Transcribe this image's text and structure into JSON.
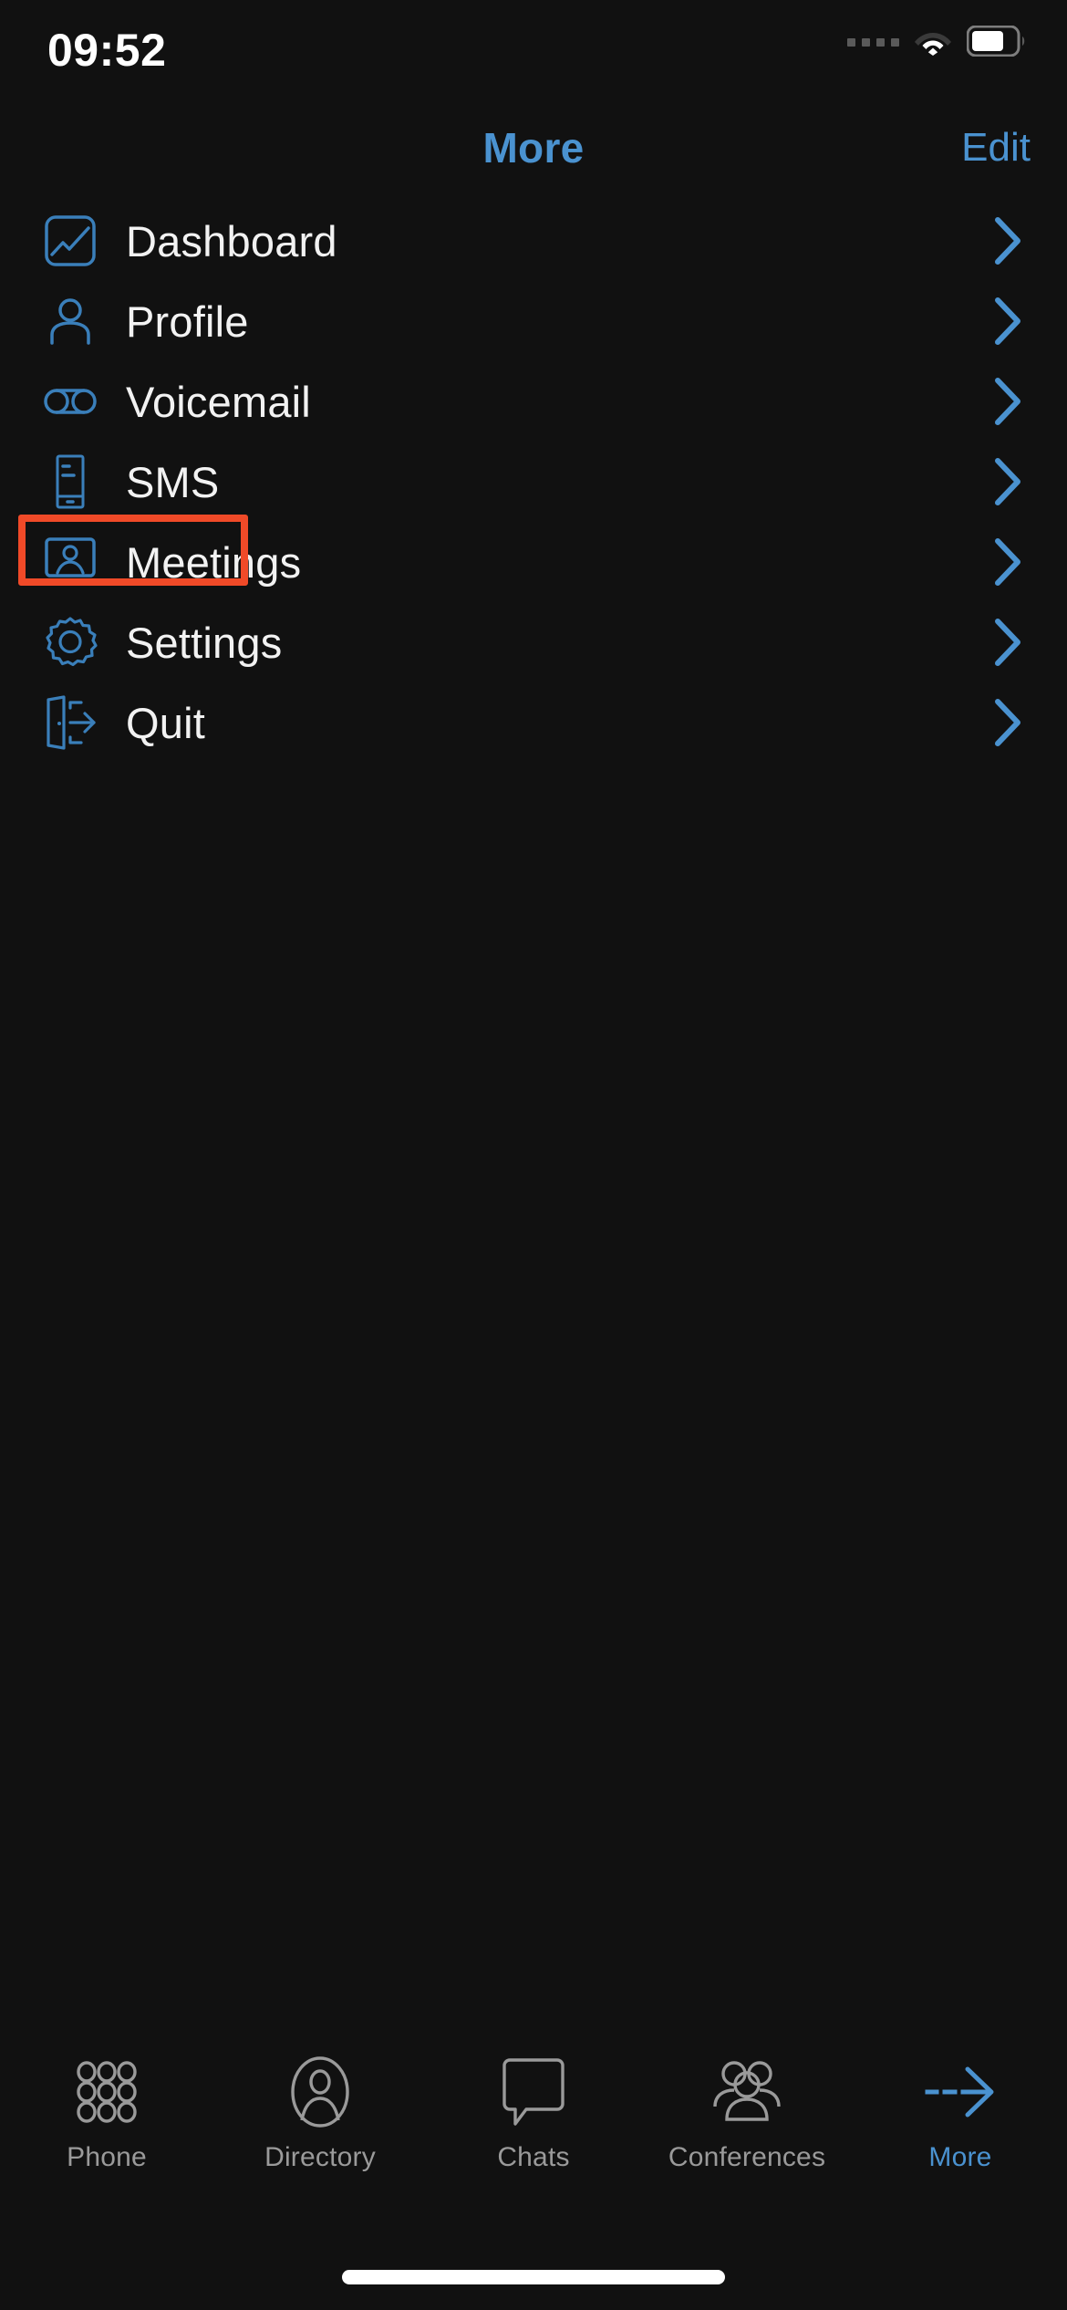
{
  "theme": {
    "background": "#111111",
    "accent_blue": "#4a92d0",
    "icon_blue": "#3a7fba",
    "text_primary": "#f2f2f2",
    "tab_inactive": "#9a9a9a",
    "highlight_box": "#f04a28"
  },
  "status_bar": {
    "time": "09:52",
    "signal_icon": "signal-dots-icon",
    "wifi_icon": "wifi-icon",
    "battery_icon": "battery-icon"
  },
  "nav_bar": {
    "title": "More",
    "edit_label": "Edit"
  },
  "menu": {
    "items": [
      {
        "label": "Dashboard",
        "icon": "dashboard-chart-icon",
        "chevron": "chevron-right-icon",
        "highlighted": false
      },
      {
        "label": "Profile",
        "icon": "person-icon",
        "chevron": "chevron-right-icon",
        "highlighted": false
      },
      {
        "label": "Voicemail",
        "icon": "voicemail-tape-icon",
        "chevron": "chevron-right-icon",
        "highlighted": false
      },
      {
        "label": "SMS",
        "icon": "phone-message-icon",
        "chevron": "chevron-right-icon",
        "highlighted": false
      },
      {
        "label": "Meetings",
        "icon": "meeting-screen-icon",
        "chevron": "chevron-right-icon",
        "highlighted": true
      },
      {
        "label": "Settings",
        "icon": "gear-icon",
        "chevron": "chevron-right-icon",
        "highlighted": false
      },
      {
        "label": "Quit",
        "icon": "exit-door-icon",
        "chevron": "chevron-right-icon",
        "highlighted": false
      }
    ]
  },
  "tab_bar": {
    "items": [
      {
        "label": "Phone",
        "icon": "dialpad-icon",
        "active": false
      },
      {
        "label": "Directory",
        "icon": "contact-oval-icon",
        "active": false
      },
      {
        "label": "Chats",
        "icon": "speech-bubble-icon",
        "active": false
      },
      {
        "label": "Conferences",
        "icon": "group-people-icon",
        "active": false
      },
      {
        "label": "More",
        "icon": "dashed-arrow-icon",
        "active": true
      }
    ]
  },
  "home_indicator": {
    "visible": true
  }
}
